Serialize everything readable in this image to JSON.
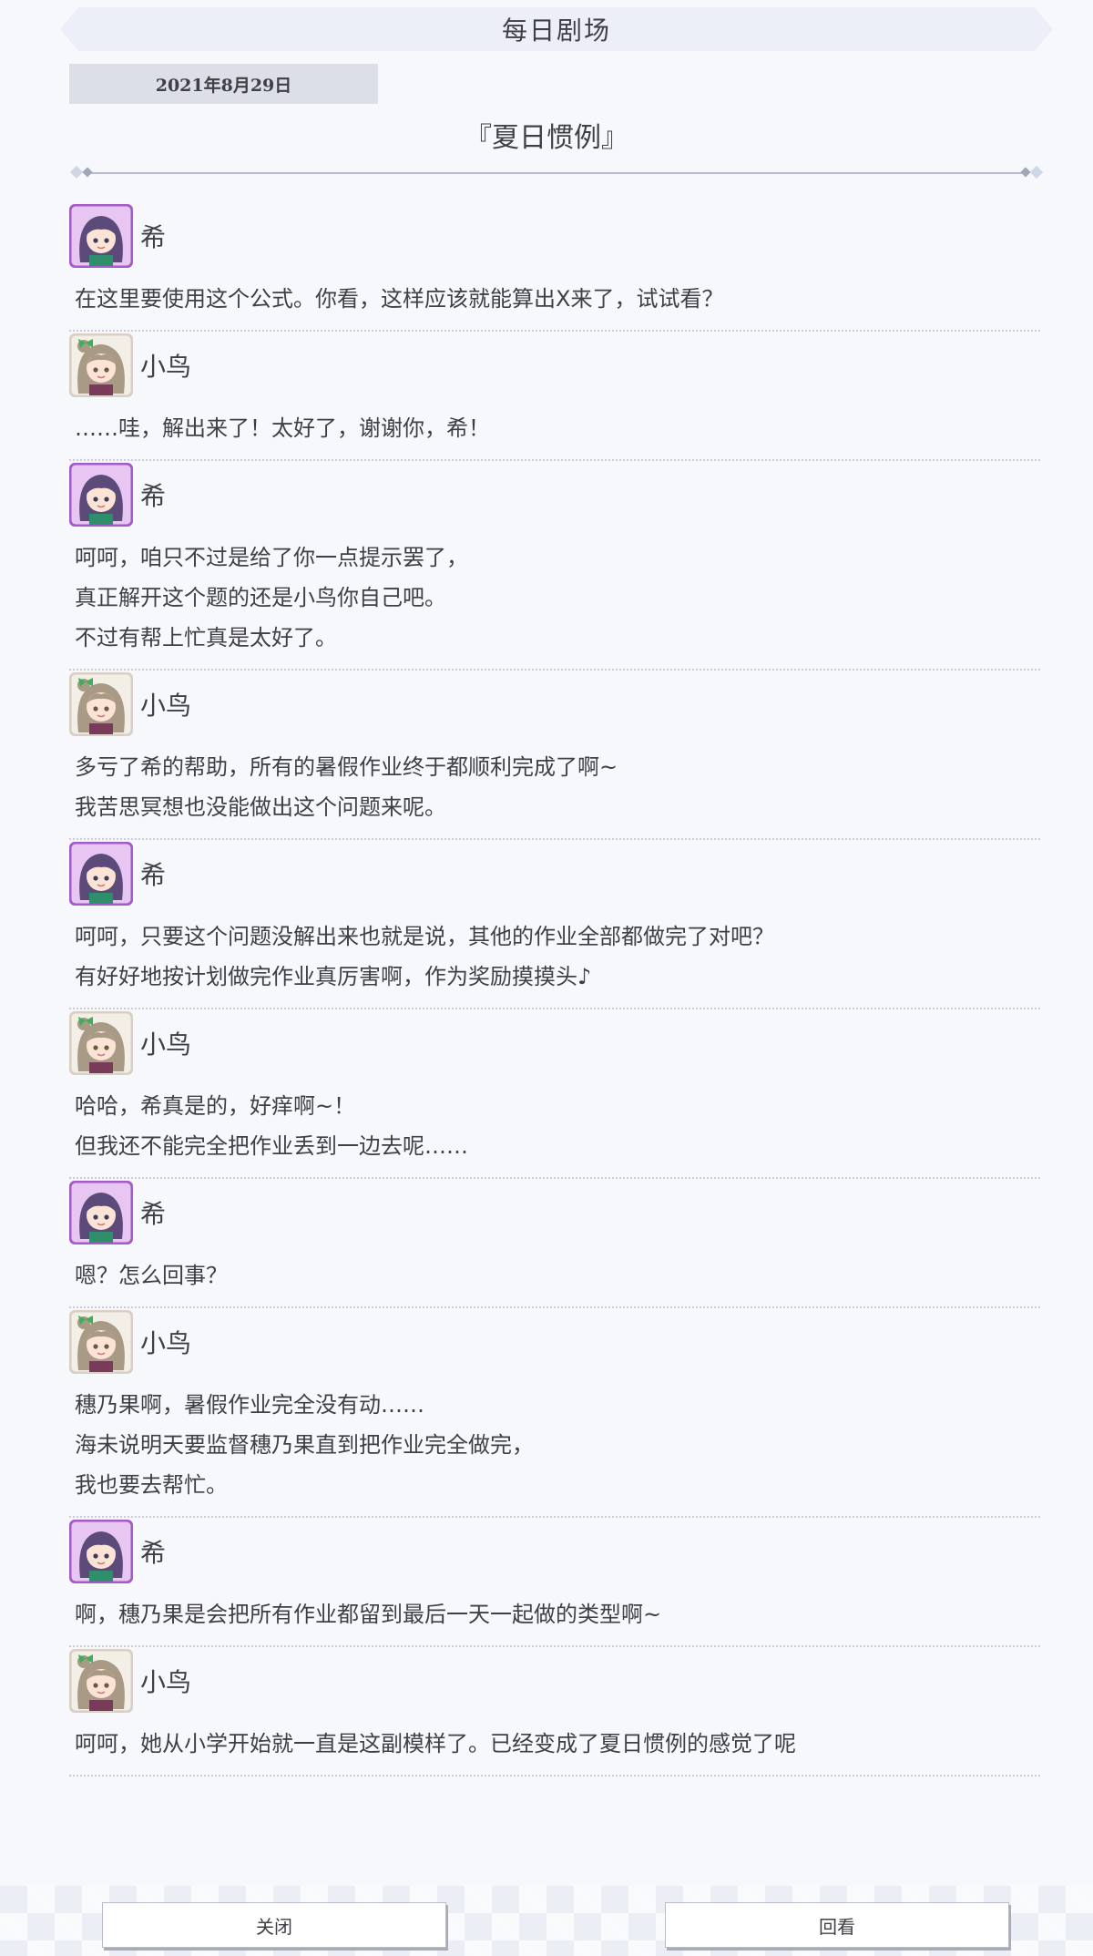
{
  "header": {
    "title": "每日剧场"
  },
  "date": "2021年8月29日",
  "story_title": "『夏日惯例』",
  "entries": [
    {
      "speaker": "希",
      "avatar": "nozomi-avatar",
      "lines": [
        "在这里要使用这个公式。你看，这样应该就能算出X来了，试试看？"
      ]
    },
    {
      "speaker": "小鸟",
      "avatar": "kotori-avatar",
      "lines": [
        "……哇，解出来了！太好了，谢谢你，希！"
      ]
    },
    {
      "speaker": "希",
      "avatar": "nozomi-avatar",
      "lines": [
        "呵呵，咱只不过是给了你一点提示罢了，",
        "真正解开这个题的还是小鸟你自己吧。",
        "不过有帮上忙真是太好了。"
      ]
    },
    {
      "speaker": "小鸟",
      "avatar": "kotori-avatar",
      "lines": [
        "多亏了希的帮助，所有的暑假作业终于都顺利完成了啊~",
        "我苦思冥想也没能做出这个问题来呢。"
      ]
    },
    {
      "speaker": "希",
      "avatar": "nozomi-avatar",
      "lines": [
        "呵呵，只要这个问题没解出来也就是说，其他的作业全部都做完了对吧？",
        "有好好地按计划做完作业真厉害啊，作为奖励摸摸头♪"
      ]
    },
    {
      "speaker": "小鸟",
      "avatar": "kotori-avatar",
      "lines": [
        "哈哈，希真是的，好痒啊~！",
        "但我还不能完全把作业丢到一边去呢……"
      ]
    },
    {
      "speaker": "希",
      "avatar": "nozomi-avatar",
      "lines": [
        "嗯？怎么回事？"
      ]
    },
    {
      "speaker": "小鸟",
      "avatar": "kotori-avatar",
      "lines": [
        "穗乃果啊，暑假作业完全没有动……",
        "海未说明天要监督穗乃果直到把作业完全做完，",
        "我也要去帮忙。"
      ]
    },
    {
      "speaker": "希",
      "avatar": "nozomi-avatar",
      "lines": [
        "啊，穗乃果是会把所有作业都留到最后一天一起做的类型啊~"
      ]
    },
    {
      "speaker": "小鸟",
      "avatar": "kotori-avatar",
      "lines": [
        "呵呵，她从小学开始就一直是这副模样了。已经变成了夏日惯例的感觉了呢"
      ]
    }
  ],
  "footer": {
    "close_label": "关闭",
    "replay_label": "回看"
  },
  "colors": {
    "nozomi_frame": "#a45ac8",
    "nozomi_hair": "#5b4a7a",
    "kotori_frame": "#d8d0c4",
    "kotori_hair": "#a89a84",
    "kotori_ribbon": "#3fae5b"
  }
}
